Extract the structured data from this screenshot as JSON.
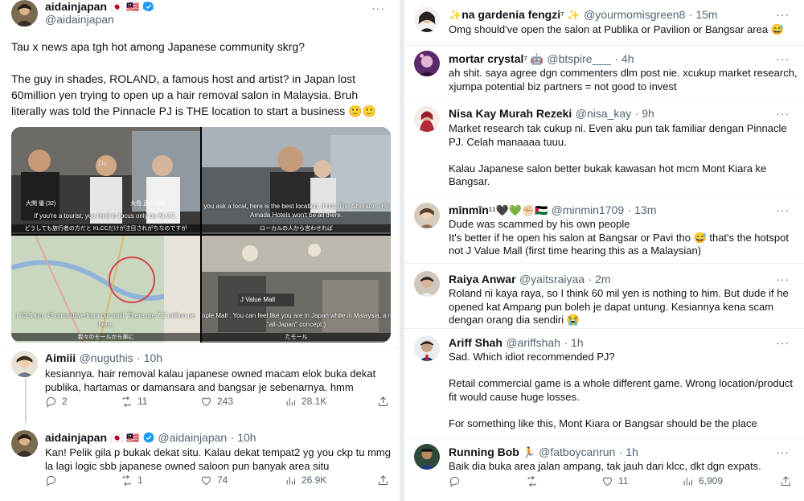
{
  "main_post": {
    "author_name": "aidainjapan",
    "flags": "🇯🇵 🇲🇾",
    "handle": "@aidainjapan",
    "text_1": "Tau x news apa tgh hot among Japanese community skrg?",
    "text_2a": "The guy in shades, ROLAND, a famous host and artist? in Japan lost",
    "text_2b": "60million yen trying to open up a hair removal salon in Malaysia. Bruh",
    "text_2c": "literally was told the Pinnacle PJ is THE location to start a business 🙂🙂",
    "media": {
      "cell1": {
        "name_tag_left": "大関 優 (32)",
        "name_tag_right": "大島 正人 (55)",
        "subtitle": "If you're a tourist, you tend to focus only on KLCC.",
        "caption_jp": "どうしても旅行者の方だと KLCCだけが注目されがちなのですが"
      },
      "cell2": {
        "subtitle_1": "you ask a local, here is the best location, if not, The Sheraton, Hil",
        "subtitle_2": "Amada Hotels won't be all there.",
        "caption_jp": "ローカルの人から言わせれば"
      },
      "cell3": {
        "subtitle_1": "t 33.5 km, 45 mins drive from our mall. There are 7.2 million pe",
        "subtitle_2": "here.",
        "caption_jp": "我々のモールから車に"
      },
      "cell4": {
        "sign": "J Value Mall",
        "subtitle_1": "ople Mall : You can feel like you are in Japan while in Malaysia, a ma",
        "subtitle_2": "\"all-Japan\" concept )",
        "caption_jp": "たモール"
      }
    }
  },
  "left_replies": [
    {
      "name": "Aimiii",
      "handle": "@nuguthis",
      "time": "· 10h",
      "text_1": "kesiannya. hair removal kalau japanese owned macam elok buka dekat",
      "text_2": "publika, hartamas or damansara and bangsar je sebenarnya. hmm",
      "replies": "2",
      "retweets": "11",
      "likes": "243",
      "views": "28.1K"
    },
    {
      "name": "aidainjapan",
      "flags": "🇯🇵 🇲🇾",
      "handle": "@aidainjapan",
      "time": "· 10h",
      "text_1": "Kan! Pelik gila p bukak dekat situ. Kalau dekat tempat2 yg you ckp tu mmg",
      "text_2": "la lagi logic sbb japanese owned saloon pun banyak area situ",
      "replies": "",
      "retweets": "1",
      "likes": "74",
      "views": "26.9K"
    }
  ],
  "right_replies": [
    {
      "name_prefix": "✨",
      "name": "na gardenia fengzi",
      "name_suffix": "⁷ ✨",
      "handle": "@yourmomisgreen8",
      "time": "· 15m",
      "lines": [
        "Omg should've open the salon at Publika or Pavilion or Bangsar area 😅"
      ]
    },
    {
      "name": "mortar crystal",
      "name_suffix": "⁷ 🤖",
      "handle": "@btspire___",
      "time": "· 4h",
      "lines": [
        "ah shit. saya agree dgn commenters dlm post nie. xcukup market research,",
        "xjumpa potential biz partners = not good to invest"
      ]
    },
    {
      "name": "Nisa Kay Murah Rezeki",
      "handle": "@nisa_kay",
      "time": "· 9h",
      "lines": [
        "Market research tak cukup ni. Even aku pun tak familiar dengan Pinnacle",
        "PJ. Celah manaaaa tuuu.",
        "",
        "Kalau Japanese salon better bukak kawasan hot mcm Mont Kiara ke",
        "Bangsar."
      ]
    },
    {
      "name": "mīnmīn",
      "name_suffix": "¹¹🖤💚✊🏻🇵🇸",
      "handle": "@minmin1709",
      "time": "· 13m",
      "lines": [
        "Dude was scammed by his own people",
        "It's better if he open his salon at Bangsar or Pavi tho 😅 that's the hotspot",
        "not J Value Mall (first time hearing this as a Malaysian)"
      ]
    },
    {
      "name": "Raiya Anwar",
      "handle": "@yaitsraiyaa",
      "time": "· 2m",
      "lines": [
        "Roland ni kaya raya, so I think 60 mil yen is nothing to him. But dude if he",
        "opened kat Ampang pun boleh je dapat untung. Kesiannya kena scam",
        "dengan orang dia sendiri 😭"
      ]
    },
    {
      "name": "Ariff Shah",
      "handle": "@ariffshah",
      "time": "· 1h",
      "lines": [
        "Sad. Which idiot recommended PJ?",
        "",
        "Retail commercial game is a whole different game. Wrong location/product",
        "fit would cause huge losses.",
        "",
        "For something like this, Mont Kiara or Bangsar should be the place"
      ]
    },
    {
      "name": "Running Bob",
      "name_suffix": " 🏃",
      "handle": "@fatboycanrun",
      "time": "· 1h",
      "lines": [
        "Baik dia buka area jalan ampang, tak jauh dari klcc, dkt dgn expats."
      ],
      "replies": "",
      "retweets": "",
      "likes": "11",
      "views": "6,909"
    }
  ],
  "more_label": "···",
  "colors": {
    "accent": "#1d9bf0",
    "text": "#0f1419",
    "muted": "#536471"
  }
}
